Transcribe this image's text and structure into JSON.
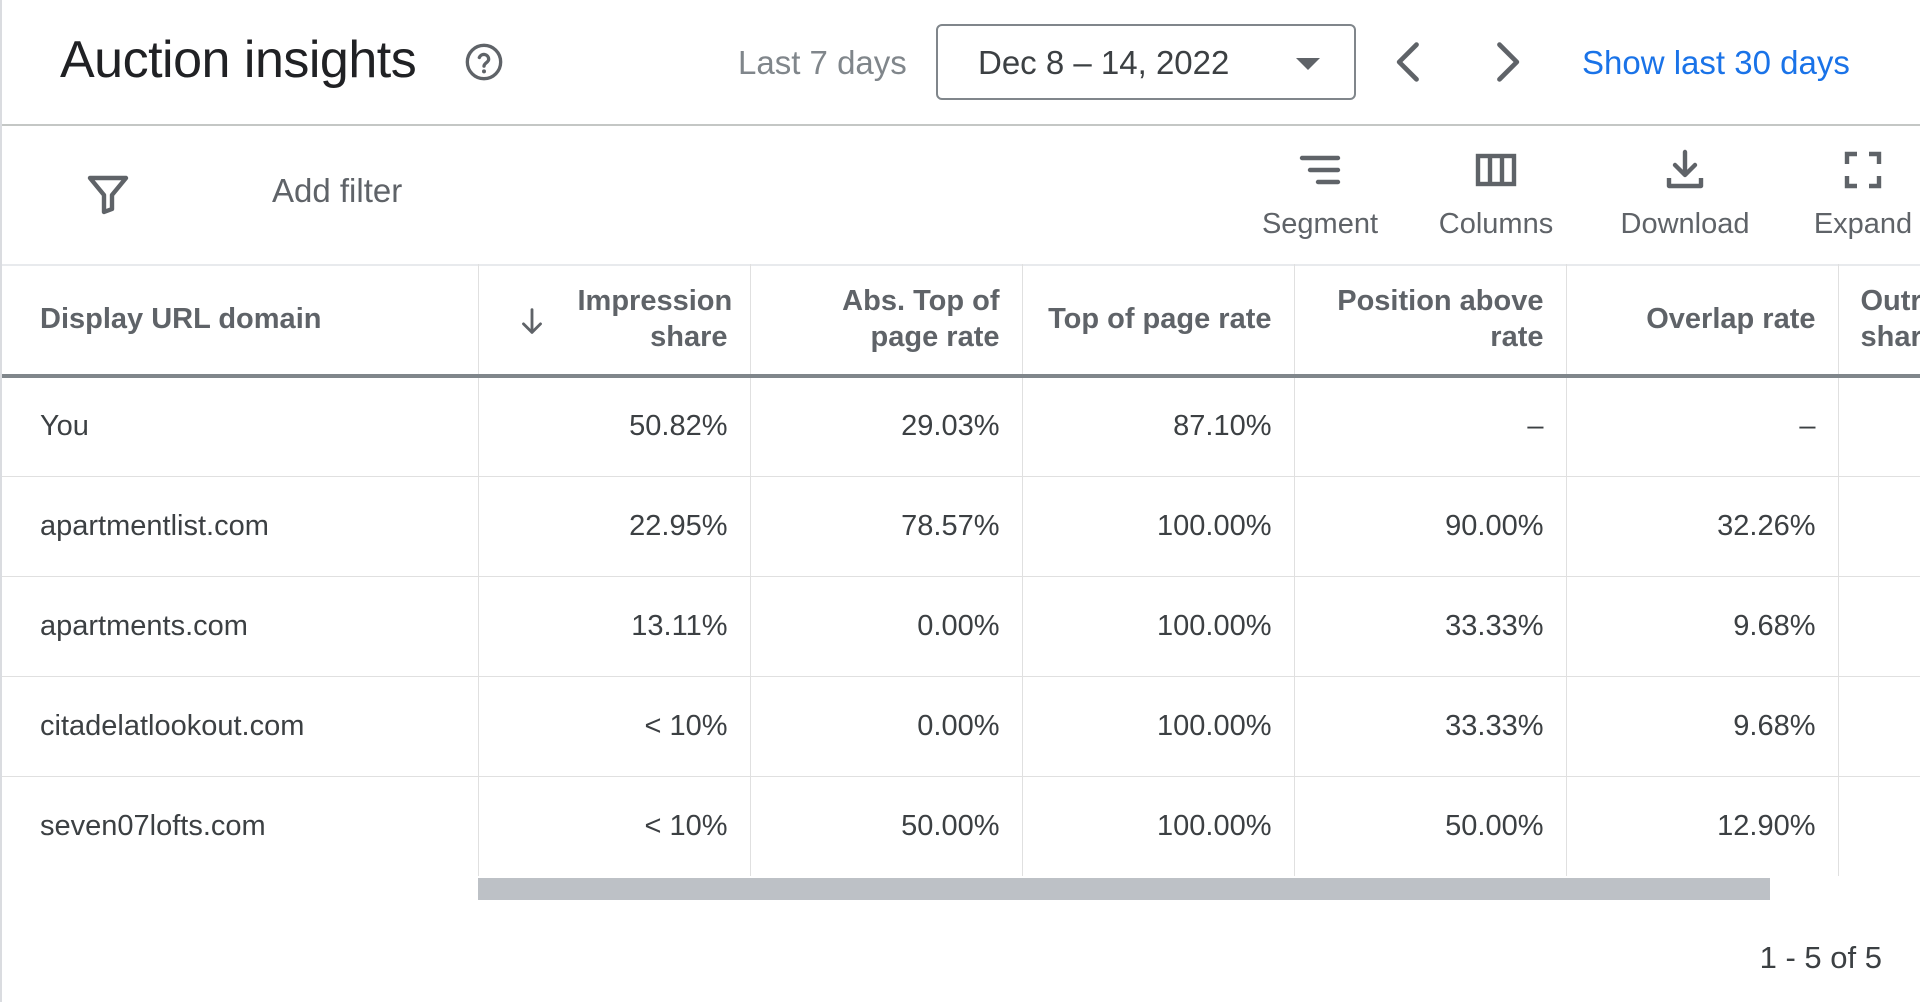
{
  "header": {
    "title": "Auction insights",
    "help_icon": "help-circle-icon",
    "range_label": "Last 7 days",
    "date_range": "Dec 8 – 14, 2022",
    "prev_icon": "chevron-left-icon",
    "next_icon": "chevron-right-icon",
    "show_last_30": "Show last 30 days",
    "link_color": "#1a73e8"
  },
  "toolbar": {
    "filter_icon": "filter-icon",
    "add_filter": "Add filter",
    "segment_label": "Segment",
    "columns_label": "Columns",
    "download_label": "Download",
    "expand_label": "Expand"
  },
  "table": {
    "columns": [
      "Display URL domain",
      "Impression share",
      "Abs. Top of page rate",
      "Top of page rate",
      "Position above rate",
      "Overlap rate",
      "Outranking share"
    ],
    "sort_icon": "arrow-down-icon",
    "rows": [
      {
        "domain": "You",
        "impression_share": "50.82%",
        "abs_top": "29.03%",
        "top": "87.10%",
        "position_above": "–",
        "overlap": "–"
      },
      {
        "domain": "apartmentlist.com",
        "impression_share": "22.95%",
        "abs_top": "78.57%",
        "top": "100.00%",
        "position_above": "90.00%",
        "overlap": "32.26%"
      },
      {
        "domain": "apartments.com",
        "impression_share": "13.11%",
        "abs_top": "0.00%",
        "top": "100.00%",
        "position_above": "33.33%",
        "overlap": "9.68%"
      },
      {
        "domain": "citadelatlookout.com",
        "impression_share": "< 10%",
        "abs_top": "0.00%",
        "top": "100.00%",
        "position_above": "33.33%",
        "overlap": "9.68%"
      },
      {
        "domain": "seven07lofts.com",
        "impression_share": "< 10%",
        "abs_top": "50.00%",
        "top": "100.00%",
        "position_above": "50.00%",
        "overlap": "12.90%"
      }
    ]
  },
  "pagination": "1 - 5 of 5"
}
